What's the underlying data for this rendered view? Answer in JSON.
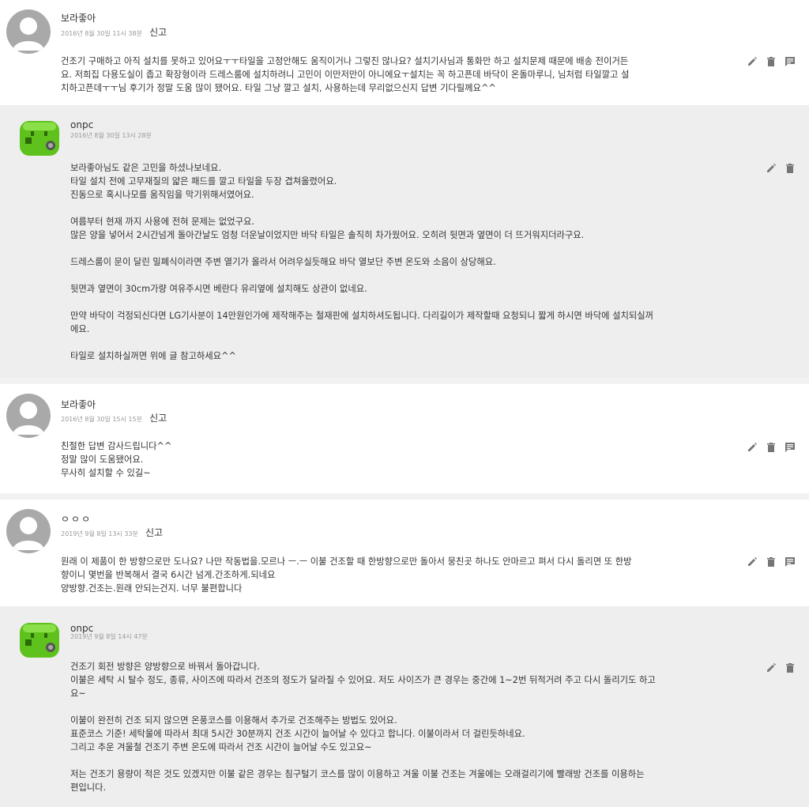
{
  "comments": [
    {
      "author": "보라좋아",
      "date": "2016년 8월 30일 11시 38분",
      "report": "신고",
      "body": "건조기 구매하고 아직 설치를 못하고 있어요ㅜㅜ타일을 고정안해도 움직이거나 그렇진 않나요? 설치기사님과 통화만 하고 설치문제 때문에 배송 전이거든\n요. 저희집 다용도실이 좁고 확장형이라 드레스룸에 설치하려니 고민이 이만저만이 아니에요ㅜ설치는 꼭 하고픈데 바닥이 온돌마루니, 님처럼 타일깔고 설\n치하고픈데ㅜㅜ님 후기가 정말 도움 많이 됐어요. 타일 그냥 깔고 설치, 사용하는데 무리없으신지 답변 기다릴께요^^"
    },
    {
      "author": "onpc",
      "date": "2016년 8월 30일 13시 28분",
      "body": "보라좋아님도 같은 고민을 하셨나보네요.\n타일 설치 전에 고무재질의 얇은 패드를 깔고 타일을 두장 겹쳐올렸어요.\n진동으로 혹시나모를 움직임을 막기위해서였어요.\n\n여름부터 현재 까지 사용에 전혀 문제는 없었구요.\n많은 양을 넣어서 2시간넘게 돌아간날도 엄청 더운날이었지만 바닥 타일은 솔직히 차가웠어요. 오히려 뒷면과 옆면이 더 뜨거워지더라구요.\n\n드레스룸이 문이 달린 밀폐식이라면 주변 열기가 올라서 어려우실듯해요 바닥 열보단 주변 온도와 소음이 상당해요.\n\n뒷면과 옆면이 30cm가량 여유주시면 베란다 유리옆에 설치해도 상관이 없네요.\n\n만약 바닥이 걱정되신다면 LG기사분이 14만원인가에 제작해주는 철재판에 설치하셔도됩니다. 다리길이가 제작할때 요청되니 짧게 하시면 바닥에 설치되실꺼\n에요.\n\n타일로 설치하실꺼면 위에 글 참고하세요^^"
    },
    {
      "author": "보라좋아",
      "date": "2016년 8월 30일 15시 15분",
      "report": "신고",
      "body": "친절한 답변 감사드립니다^^\n정말 많이 도움됐어요.\n무사히 설치할 수 있길~"
    },
    {
      "author": "ㅇㅇㅇ",
      "date": "2019년 9월 8일 13시 33분",
      "report": "신고",
      "body": "원래 이 제품이 한 방향으로만 도나요? 나만 작동법을.모르나 ㅡ.ㅡ 이불 건조할 때 한방향으로만 돌아서 뭉친곳 하나도 안마르고 펴서 다시 돌리면 또 한방\n향이니 몇번을 반복해서 결국 6시간 넘게.간조하게.되네요\n양방향.건조는.원래 안되는건지. 너무 불편합니다"
    },
    {
      "author": "onpc",
      "date": "2019년 9월 8일 14시 47분",
      "body": "건조기 회전 방향은 양방향으로 바꿔서 돌아갑니다.\n이불은 세탁 시 탈수 정도, 종류, 사이즈에 따라서 건조의 정도가 달라질 수 있어요. 저도 사이즈가 큰 경우는 중간에 1~2번 뒤적거려 주고 다시 돌리기도 하고\n요~\n\n이불이 완전히 건조 되지 않으면 온풍코스를 이용해서 추가로 건조해주는 방법도 있어요.\n표준코스 기준! 세탁물에 따라서 최대 5시간 30분까지 건조 시간이 늘어날 수 있다고 합니다. 이불이라서 더 걸린듯하네요.\n그리고 추운 겨울철 건조기 주변 온도에 따라서 건조 시간이 늘어날 수도 있고요~\n\n저는 건조기 용량이 적은 것도 있겠지만 이불 같은 경우는 침구털기 코스를 많이 이용하고 겨울 이불 건조는 겨울에는 오래걸리기에 빨래방 건조를 이용하는\n편입니다."
    }
  ],
  "icons": {
    "edit": "pencil-icon",
    "delete": "trash-icon",
    "reply": "comment-icon",
    "avatar_default": "user-silhouette-icon",
    "avatar_onpc": "green-robot-icon"
  },
  "colors": {
    "grey_bg": "#eeeeee",
    "icon": "#757575",
    "robot_green": "#5fc21c"
  }
}
